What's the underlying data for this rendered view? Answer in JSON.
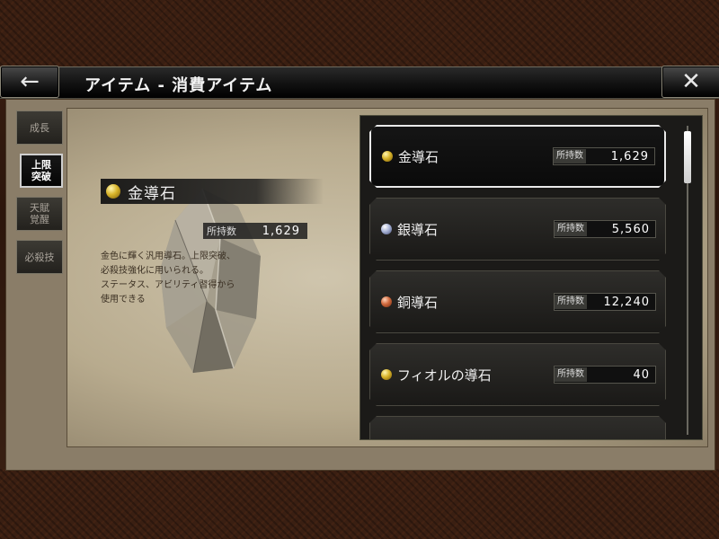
{
  "header": {
    "back_icon": "arrow-left-icon",
    "back_glyph": "←",
    "title": "アイテム - 消費アイテム",
    "close_icon": "close-icon",
    "close_glyph": "✕"
  },
  "tabs": [
    {
      "label": "成長",
      "active": false
    },
    {
      "label": "上限\n突破",
      "active": true
    },
    {
      "label": "天賦\n覚醒",
      "active": false
    },
    {
      "label": "必殺技",
      "active": false
    }
  ],
  "detail": {
    "name": "金導石",
    "icon": "gold-stone-icon",
    "count_label": "所持数",
    "count": "1,629",
    "description": [
      "金色に輝く汎用導石。上限突破、",
      "必殺技強化に用いられる。",
      "ステータス、アビリティ習得から",
      "使用できる"
    ]
  },
  "items": [
    {
      "name": "金導石",
      "icon": "gold-stone-icon",
      "count_label": "所持数",
      "count": "1,629",
      "selected": true
    },
    {
      "name": "銀導石",
      "icon": "silver-stone-icon",
      "count_label": "所持数",
      "count": "5,560",
      "selected": false
    },
    {
      "name": "銅導石",
      "icon": "copper-stone-icon",
      "count_label": "所持数",
      "count": "12,240",
      "selected": false
    },
    {
      "name": "フィオルの導石",
      "icon": "gold-stone-icon",
      "count_label": "所持数",
      "count": "40",
      "selected": false
    }
  ],
  "colors": {
    "gold": "#d8b42a",
    "silver": "#a9b4d6",
    "copper": "#d0683c",
    "selected_border": "#e9e9e9"
  }
}
